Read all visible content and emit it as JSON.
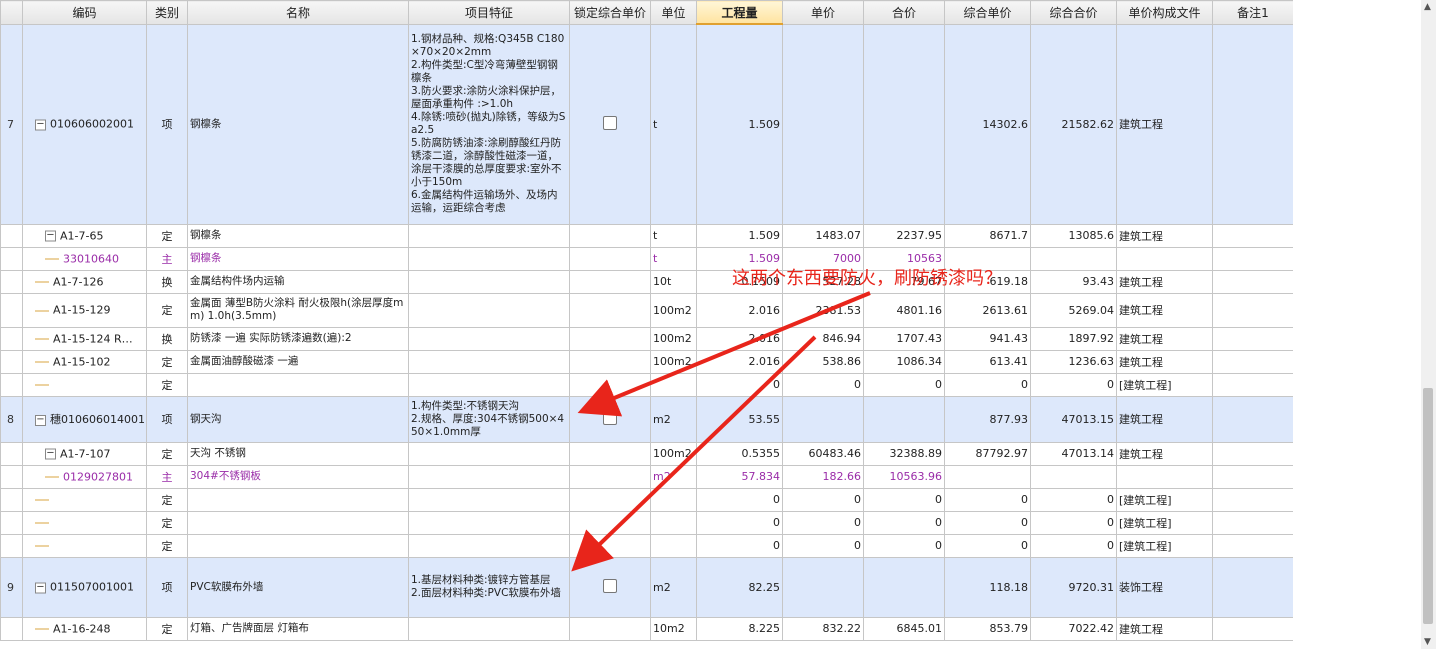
{
  "headers": [
    "",
    "编码",
    "类别",
    "名称",
    "项目特征",
    "锁定综合单价",
    "单位",
    "工程量",
    "单价",
    "合价",
    "综合单价",
    "综合合价",
    "单价构成文件",
    "备注1"
  ],
  "annotation": "这两个东西要防火，刷防锈漆吗？",
  "icons": {
    "expand": "minus-square-icon",
    "checkbox": "checkbox-icon"
  },
  "rows": [
    {
      "type": "item",
      "index": "7",
      "code": "010606002001",
      "category": "项",
      "name": "钢檩条",
      "features": "1.钢材品种、规格:Q345B C180×70×20×2mm\n2.构件类型:C型冷弯薄壁型钢钢檩条\n3.防火要求:涂防火涂料保护层，屋面承重构件 :>1.0h\n4.除锈:喷砂(抛丸)除锈，等级为Sa2.5\n5.防腐防锈油漆:涂刷醇酸红丹防锈漆二道，涂醇酸性磁漆一道，涂层干漆膜的总厚度要求:室外不小于150m\n6.金属结构件运输场外、及场内运输，运距综合考虑",
      "lock": true,
      "unit": "t",
      "qty": "1.509",
      "price": "",
      "total": "",
      "comp_price": "14302.6",
      "comp_total": "21582.62",
      "file": "建筑工程",
      "note": ""
    },
    {
      "type": "sub",
      "index": "",
      "code": "A1-7-65",
      "category": "定",
      "name": "钢檩条",
      "features": "",
      "lock": false,
      "unit": "t",
      "qty": "1.509",
      "price": "1483.07",
      "total": "2237.95",
      "comp_price": "8671.7",
      "comp_total": "13085.6",
      "file": "建筑工程",
      "note": ""
    },
    {
      "type": "main",
      "index": "",
      "code": "33010640",
      "category": "主",
      "name": "钢檩条",
      "features": "",
      "lock": false,
      "unit": "t",
      "qty": "1.509",
      "price": "7000",
      "total": "10563",
      "comp_price": "",
      "comp_total": "",
      "file": "",
      "note": ""
    },
    {
      "type": "leaf",
      "index": "",
      "code": "A1-7-126",
      "category": "换",
      "name": "金属结构件场内运输",
      "features": "",
      "lock": false,
      "unit": "10t",
      "qty": "0.1509",
      "price": "527.28",
      "total": "79.67",
      "comp_price": "619.18",
      "comp_total": "93.43",
      "file": "建筑工程",
      "note": ""
    },
    {
      "type": "leaf",
      "index": "",
      "code": "A1-15-129",
      "category": "定",
      "name": "金属面 薄型B防火涂料 耐火极限h(涂层厚度mm) 1.0h(3.5mm)",
      "features": "",
      "lock": false,
      "unit": "100m2",
      "qty": "2.016",
      "price": "2381.53",
      "total": "4801.16",
      "comp_price": "2613.61",
      "comp_total": "5269.04",
      "file": "建筑工程",
      "note": ""
    },
    {
      "type": "leaf",
      "index": "",
      "code": "A1-15-124 R…",
      "category": "换",
      "name": "防锈漆 一遍  实际防锈漆遍数(遍):2",
      "features": "",
      "lock": false,
      "unit": "100m2",
      "qty": "2.016",
      "price": "846.94",
      "total": "1707.43",
      "comp_price": "941.43",
      "comp_total": "1897.92",
      "file": "建筑工程",
      "note": ""
    },
    {
      "type": "leaf",
      "index": "",
      "code": "A1-15-102",
      "category": "定",
      "name": "金属面油醇酸磁漆 一遍",
      "features": "",
      "lock": false,
      "unit": "100m2",
      "qty": "2.016",
      "price": "538.86",
      "total": "1086.34",
      "comp_price": "613.41",
      "comp_total": "1236.63",
      "file": "建筑工程",
      "note": ""
    },
    {
      "type": "leaf",
      "index": "",
      "code": "",
      "category": "定",
      "name": "",
      "features": "",
      "lock": false,
      "unit": "",
      "qty": "0",
      "price": "0",
      "total": "0",
      "comp_price": "0",
      "comp_total": "0",
      "file": "[建筑工程]",
      "note": ""
    },
    {
      "type": "item",
      "index": "8",
      "code": "穗010606014001",
      "category": "项",
      "name": "钢天沟",
      "features": "1.构件类型:不锈钢天沟\n2.规格、厚度:304不锈钢500×450×1.0mm厚",
      "lock": true,
      "unit": "m2",
      "qty": "53.55",
      "price": "",
      "total": "",
      "comp_price": "877.93",
      "comp_total": "47013.15",
      "file": "建筑工程",
      "note": ""
    },
    {
      "type": "sub",
      "index": "",
      "code": "A1-7-107",
      "category": "定",
      "name": "天沟 不锈钢",
      "features": "",
      "lock": false,
      "unit": "100m2",
      "qty": "0.5355",
      "price": "60483.46",
      "total": "32388.89",
      "comp_price": "87792.97",
      "comp_total": "47013.14",
      "file": "建筑工程",
      "note": ""
    },
    {
      "type": "main",
      "index": "",
      "code": "0129027801",
      "category": "主",
      "name": "304#不锈钢板",
      "features": "",
      "lock": false,
      "unit": "m2",
      "qty": "57.834",
      "price": "182.66",
      "total": "10563.96",
      "comp_price": "",
      "comp_total": "",
      "file": "",
      "note": ""
    },
    {
      "type": "leaf",
      "index": "",
      "code": "",
      "category": "定",
      "name": "",
      "features": "",
      "lock": false,
      "unit": "",
      "qty": "0",
      "price": "0",
      "total": "0",
      "comp_price": "0",
      "comp_total": "0",
      "file": "[建筑工程]",
      "note": ""
    },
    {
      "type": "leaf",
      "index": "",
      "code": "",
      "category": "定",
      "name": "",
      "features": "",
      "lock": false,
      "unit": "",
      "qty": "0",
      "price": "0",
      "total": "0",
      "comp_price": "0",
      "comp_total": "0",
      "file": "[建筑工程]",
      "note": ""
    },
    {
      "type": "leaf",
      "index": "",
      "code": "",
      "category": "定",
      "name": "",
      "features": "",
      "lock": false,
      "unit": "",
      "qty": "0",
      "price": "0",
      "total": "0",
      "comp_price": "0",
      "comp_total": "0",
      "file": "[建筑工程]",
      "note": ""
    },
    {
      "type": "item",
      "index": "9",
      "code": "011507001001",
      "category": "项",
      "name": "PVC软膜布外墙",
      "features": "1.基层材料种类:镀锌方管基层\n2.面层材料种类:PVC软膜布外墙",
      "lock": true,
      "unit": "m2",
      "qty": "82.25",
      "price": "",
      "total": "",
      "comp_price": "118.18",
      "comp_total": "9720.31",
      "file": "装饰工程",
      "note": ""
    },
    {
      "type": "leaf",
      "index": "",
      "code": "A1-16-248",
      "category": "定",
      "name": "灯箱、广告牌面层 灯箱布",
      "features": "",
      "lock": false,
      "unit": "10m2",
      "qty": "8.225",
      "price": "832.22",
      "total": "6845.01",
      "comp_price": "853.79",
      "comp_total": "7022.42",
      "file": "建筑工程",
      "note": ""
    }
  ]
}
